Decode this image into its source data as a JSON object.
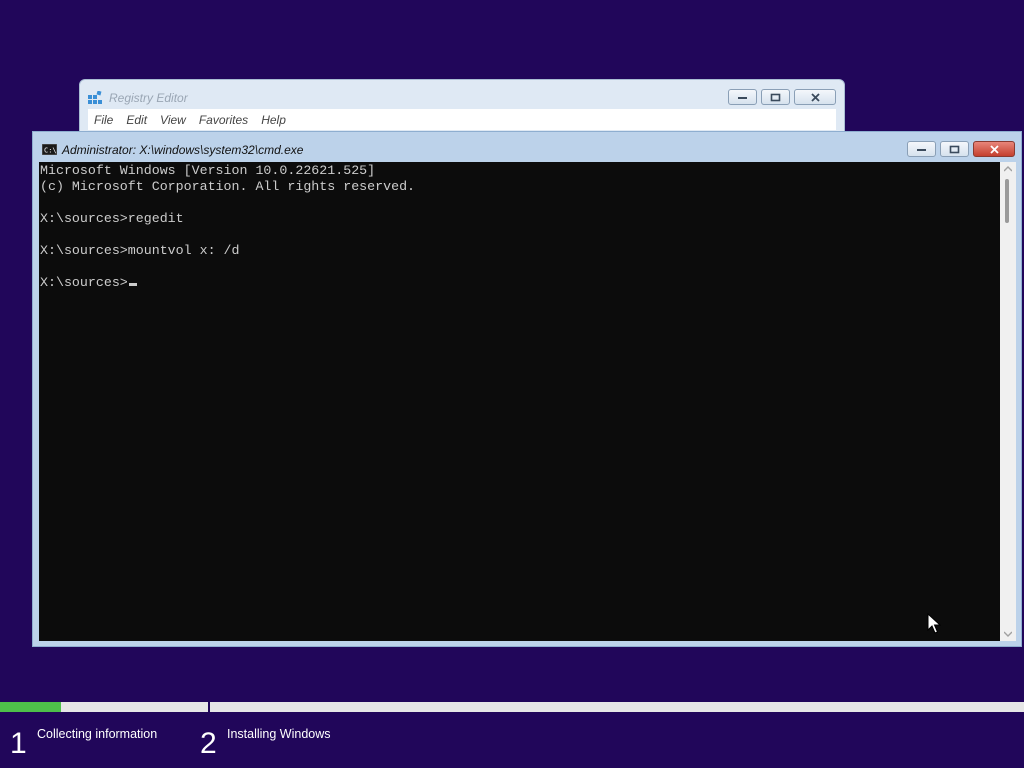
{
  "registry_editor": {
    "title": "Registry Editor",
    "menu": [
      "File",
      "Edit",
      "View",
      "Favorites",
      "Help"
    ]
  },
  "cmd": {
    "title": "Administrator: X:\\windows\\system32\\cmd.exe",
    "lines": [
      "Microsoft Windows [Version 10.0.22621.525]",
      "(c) Microsoft Corporation. All rights reserved.",
      "",
      "X:\\sources>regedit",
      "",
      "X:\\sources>mountvol x: /d",
      "",
      "X:\\sources>"
    ]
  },
  "setup": {
    "progress": 0.06,
    "steps": [
      {
        "number": "1",
        "label": "Collecting information"
      },
      {
        "number": "2",
        "label": "Installing Windows"
      }
    ]
  },
  "colors": {
    "background": "#21065a",
    "progress": "#4ec04a",
    "console": "#0c0c0c",
    "console_text": "#cccccc"
  },
  "icons": {
    "registry": "registry-editor-icon",
    "cmd": "command-prompt-icon",
    "minimize": "minimize-icon",
    "maximize": "maximize-icon",
    "close": "close-icon",
    "pointer": "mouse-pointer-icon"
  }
}
